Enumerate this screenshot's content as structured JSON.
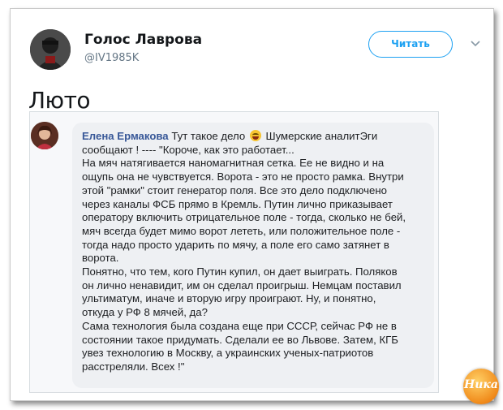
{
  "tweet": {
    "author_name": "Голос Лаврова",
    "author_handle": "@IV1985K",
    "follow_label": "Читать",
    "text": "Люто"
  },
  "quote": {
    "name": "Елена Ермакова",
    "lines": [
      "Тут такое дело",
      "Шумерские аналитЭги",
      "сообщают ! ---- \"Короче, как это работает...",
      "На мяч натягивается наномагнитная сетка. Ее не видно и на",
      "ощупь она не чувствуется. Ворота - это не просто рамка. Внутри",
      "этой \"рамки\" стоит генератор поля. Все это дело подключено",
      "через каналы ФСБ прямо в Кремль. Путин лично приказывает",
      "оператору включить отрицательное поле - тогда, сколько не бей,",
      "мяч всегда будет мимо ворот лететь, или положительное поле -",
      "тогда надо просто ударить по мячу, а поле его само затянет в",
      "ворота.",
      "Понятно, что тем, кого Путин купил, он дает выиграть. Поляков",
      "он лично ненавидит, им он сделал проигрыш. Немцам поставил",
      "ультиматум, иначе и вторую игру проиграют. Ну, и понятно,",
      "откуда у РФ 8 мячей, да?",
      "Сама технология была создана еще при СССР, сейчас РФ не в",
      "состоянии такое придумать. Сделали ее во Львове. Затем, КГБ",
      "увез технологию в Москву, а украинских ученых-патриотов",
      "расстреляли. Всех !\""
    ]
  },
  "watermark": {
    "text": "Ника"
  },
  "icons": {
    "caret": "chevron-down-icon",
    "emoji": "laughing-emoji-icon"
  },
  "colors": {
    "link": "#1da1f2",
    "quote_name": "#385898",
    "handle": "#657786"
  }
}
